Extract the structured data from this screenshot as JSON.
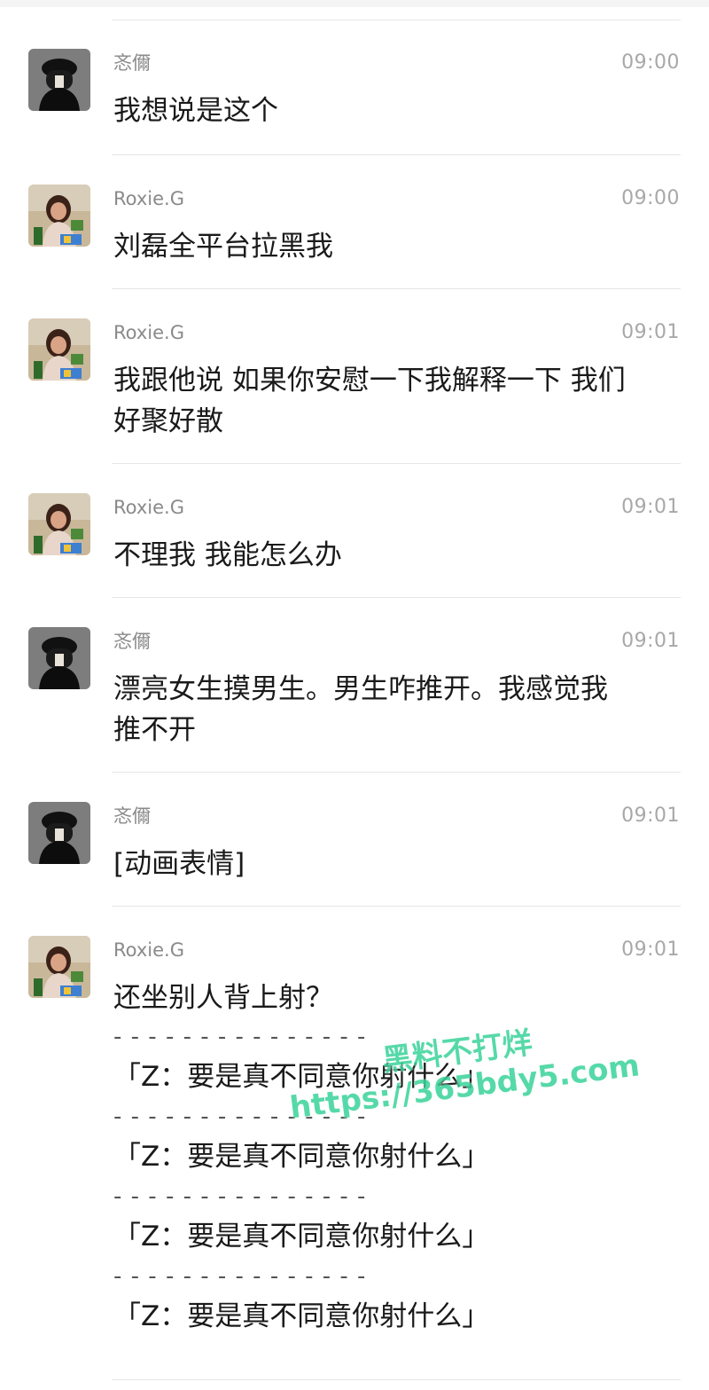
{
  "messages": [
    {
      "sender": "忞儞",
      "time": "09:00",
      "avatar": "avatar-dark",
      "lines": [
        "我想说是这个"
      ]
    },
    {
      "sender": "Roxie.G",
      "time": "09:00",
      "avatar": "avatar-colorful",
      "lines": [
        "刘磊全平台拉黑我"
      ]
    },
    {
      "sender": "Roxie.G",
      "time": "09:01",
      "avatar": "avatar-colorful",
      "lines": [
        "我跟他说 如果你安慰一下我解释一下 我们",
        "好聚好散"
      ]
    },
    {
      "sender": "Roxie.G",
      "time": "09:01",
      "avatar": "avatar-colorful",
      "lines": [
        "不理我 我能怎么办"
      ]
    },
    {
      "sender": "忞儞",
      "time": "09:01",
      "avatar": "avatar-dark",
      "lines": [
        "漂亮女生摸男生。男生咋推开。我感觉我",
        "推不开"
      ]
    },
    {
      "sender": "忞儞",
      "time": "09:01",
      "avatar": "avatar-dark",
      "lines": [
        "[动画表情]"
      ]
    },
    {
      "sender": "Roxie.G",
      "time": "09:01",
      "avatar": "avatar-colorful",
      "lines": [
        "还坐别人背上射？"
      ],
      "separator": "- - - - - - - - - - - - - - -",
      "quotes": [
        "「Z：要是真不同意你射什么」",
        "「Z：要是真不同意你射什么」",
        "「Z：要是真不同意你射什么」",
        "「Z：要是真不同意你射什么」"
      ]
    }
  ],
  "watermark": {
    "line1": "黑料不打烊",
    "line2": "https://365bdy5.com"
  },
  "colors": {
    "sender": "#8a8a8a",
    "time": "#a8a8a8",
    "divider": "#e6e6e6",
    "watermark": "#39d39a"
  }
}
